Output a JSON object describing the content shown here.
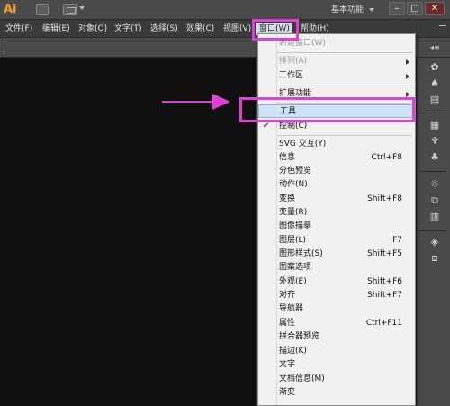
{
  "app": {
    "logo": "Ai",
    "workspace": "基本功能",
    "window_buttons": {
      "minimize": "–",
      "maximize": "□",
      "close": "✕"
    }
  },
  "menubar": {
    "items": [
      {
        "label": "文件(F)"
      },
      {
        "label": "编辑(E)"
      },
      {
        "label": "对象(O)"
      },
      {
        "label": "文字(T)"
      },
      {
        "label": "选择(S)"
      },
      {
        "label": "效果(C)"
      },
      {
        "label": "视图(V)"
      },
      {
        "label": "窗口(W)"
      },
      {
        "label": "帮助(H)"
      }
    ],
    "active": "窗口(W)"
  },
  "window_menu": {
    "items": [
      {
        "label": "新建窗口(W)",
        "disabled": true
      },
      {
        "label": "排列(A)",
        "submenu": true,
        "disabled": true
      },
      {
        "label": "工作区",
        "submenu": true
      },
      {
        "label": "扩展功能",
        "submenu": true
      },
      {
        "label": "工具",
        "highlighted": true
      },
      {
        "label": "控制(C)",
        "checked": true
      },
      {
        "label": "SVG 交互(Y)"
      },
      {
        "label": "信息",
        "shortcut": "Ctrl+F8"
      },
      {
        "label": "分色预览"
      },
      {
        "label": "动作(N)"
      },
      {
        "label": "变换",
        "shortcut": "Shift+F8"
      },
      {
        "label": "变量(R)"
      },
      {
        "label": "图像描摹"
      },
      {
        "label": "图层(L)",
        "shortcut": "F7"
      },
      {
        "label": "图形样式(S)",
        "shortcut": "Shift+F5"
      },
      {
        "label": "图案选项"
      },
      {
        "label": "外观(E)",
        "shortcut": "Shift+F6"
      },
      {
        "label": "对齐",
        "shortcut": "Shift+F7"
      },
      {
        "label": "导航器"
      },
      {
        "label": "属性",
        "shortcut": "Ctrl+F11"
      },
      {
        "label": "拼合器预览"
      },
      {
        "label": "描边(K)"
      },
      {
        "label": "文字"
      },
      {
        "label": "文档信息(M)"
      },
      {
        "label": "渐变"
      }
    ]
  },
  "panel_icons": [
    "brush-icon",
    "symbol-icon",
    "swatches-icon",
    "brush-library-icon",
    "spray-icon",
    "club-icon",
    "sun-icon",
    "transform-icon",
    "align-icon",
    "layers-icon",
    "artboards-icon"
  ],
  "colors": {
    "highlight": "#e040d8",
    "menu_bg": "#f1f1f1",
    "canvas": "#0f0f0f",
    "accent_logo": "#f7a21b"
  }
}
